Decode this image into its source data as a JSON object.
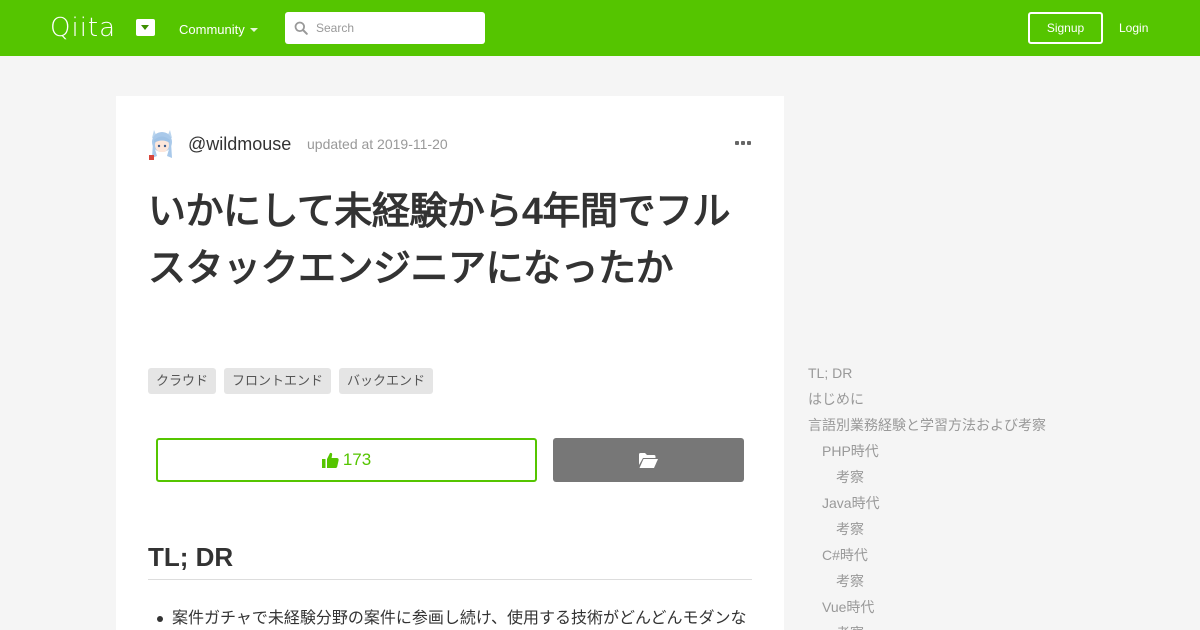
{
  "header": {
    "logo": "Qiita",
    "community_label": "Community",
    "search_placeholder": "Search",
    "signup_label": "Signup",
    "login_label": "Login",
    "brand_color": "#55c500"
  },
  "article": {
    "author": "@wildmouse",
    "updated": "updated at 2019-11-20",
    "title": "いかにして未経験から4年間でフルスタックエンジニアになったか",
    "tags": [
      "クラウド",
      "フロントエンド",
      "バックエンド"
    ],
    "likes": "173",
    "section_heading": "TL; DR",
    "first_bullet": "案件ガチャで未経験分野の案件に参画し続け、使用する技術がどんどんモダンな"
  },
  "toc": [
    {
      "label": "TL; DR",
      "level": 1
    },
    {
      "label": "はじめに",
      "level": 1
    },
    {
      "label": "言語別業務経験と学習方法および考察",
      "level": 1
    },
    {
      "label": "PHP時代",
      "level": 2
    },
    {
      "label": "考察",
      "level": 3
    },
    {
      "label": "Java時代",
      "level": 2
    },
    {
      "label": "考察",
      "level": 3
    },
    {
      "label": "C#時代",
      "level": 2
    },
    {
      "label": "考察",
      "level": 3
    },
    {
      "label": "Vue時代",
      "level": 2
    },
    {
      "label": "考察",
      "level": 3
    }
  ]
}
